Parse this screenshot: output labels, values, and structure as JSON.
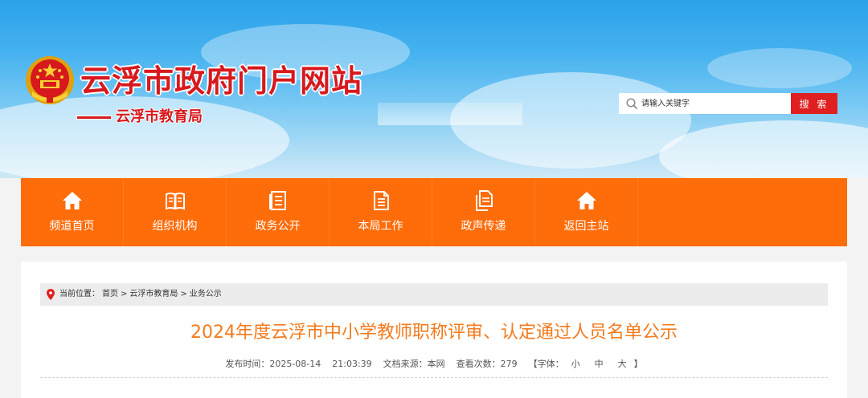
{
  "header": {
    "site_title": "云浮市政府门户网站",
    "sub_title": "云浮市教育局",
    "search": {
      "placeholder": "请输入关键字",
      "button_label": "搜 索"
    }
  },
  "nav": {
    "items": [
      {
        "label": "频道首页",
        "icon": "home-icon"
      },
      {
        "label": "组织机构",
        "icon": "book-icon"
      },
      {
        "label": "政务公开",
        "icon": "document-list-icon"
      },
      {
        "label": "本局工作",
        "icon": "file-icon"
      },
      {
        "label": "政声传递",
        "icon": "file-copy-icon"
      },
      {
        "label": "返回主站",
        "icon": "home-icon"
      }
    ]
  },
  "breadcrumb": {
    "prefix": "当前位置：",
    "items": [
      "首页",
      "云浮市教育局",
      "业务公示"
    ],
    "separator": ">"
  },
  "article": {
    "title": "2024年度云浮市中小学教师职称评审、认定通过人员名单公示",
    "meta": {
      "published_label": "发布时间：",
      "published_date": "2025-08-14",
      "published_time": "21:03:39",
      "source_label": "文档来源：",
      "source": "本网",
      "views_label": "查看次数：",
      "views": "279",
      "font_label": "【字体：",
      "font_small": "小",
      "font_medium": "中",
      "font_large": "大",
      "font_close": "】"
    }
  },
  "colors": {
    "brand_red": "#d7191d",
    "nav_orange": "#ff6c0a",
    "title_orange": "#f37b1d",
    "search_button_red": "#e02020"
  }
}
